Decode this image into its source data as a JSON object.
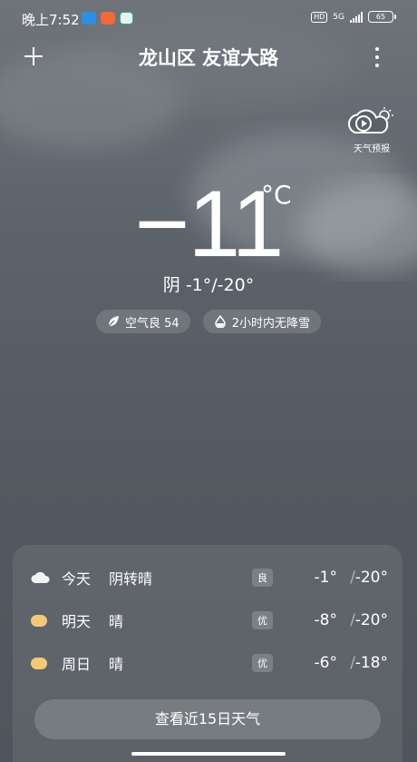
{
  "status_bar": {
    "time": "晚上7:52",
    "hd": "HD",
    "network": "5G",
    "battery": "65",
    "app_icon_colors": [
      "#2e8fe8",
      "#ef6b3b",
      "#2fb37b"
    ]
  },
  "header": {
    "location": "龙山区 友谊大路",
    "add_icon": "plus-icon",
    "more_icon": "more-vertical-icon"
  },
  "video_forecast": {
    "label": "天气预报",
    "icon": "play-cloud-icon"
  },
  "current": {
    "temp": "−11",
    "unit": "°C",
    "condition": "阴  -1°/-20°",
    "chips": [
      {
        "icon": "leaf-icon",
        "text": "空气良 54"
      },
      {
        "icon": "drop-icon",
        "text": "2小时内无降雪"
      }
    ]
  },
  "forecast": [
    {
      "day": "今天",
      "weather": "阴转晴",
      "aqi": "良",
      "high": "-1°",
      "low": "-20°",
      "icon": "cloud-icon"
    },
    {
      "day": "明天",
      "weather": "晴",
      "aqi": "优",
      "high": "-8°",
      "low": "-20°",
      "icon": "sun-icon"
    },
    {
      "day": "周日",
      "weather": "晴",
      "aqi": "优",
      "high": "-6°",
      "low": "-18°",
      "icon": "sun-icon"
    }
  ],
  "separator": "/",
  "button_15day": "查看近15日天气"
}
